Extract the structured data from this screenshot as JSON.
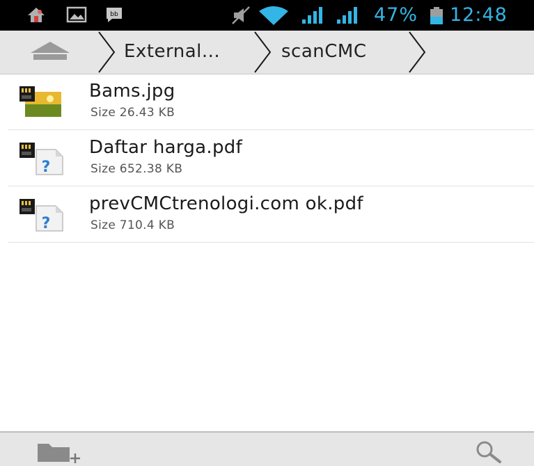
{
  "status_bar": {
    "icons": [
      "home-notification-icon",
      "gallery-notification-icon",
      "bbm-notification-icon",
      "mute-icon",
      "wifi-icon",
      "signal-icon",
      "signal-icon",
      "battery-icon"
    ],
    "battery": "47%",
    "time": "12:48",
    "accent_color": "#33b5e5"
  },
  "breadcrumb": {
    "home_icon": "home-icon",
    "items": [
      {
        "label": "External..."
      },
      {
        "label": "scanCMC"
      }
    ]
  },
  "files": [
    {
      "name": "Bams.jpg",
      "size": "Size 26.43 KB",
      "icon": "image-file-icon"
    },
    {
      "name": "Daftar harga.pdf",
      "size": "Size 652.38 KB",
      "icon": "unknown-file-icon"
    },
    {
      "name": "prevCMCtrenologi.com ok.pdf",
      "size": "Size 710.4 KB",
      "icon": "unknown-file-icon"
    }
  ],
  "toolbar": {
    "new_folder_icon": "new-folder-icon",
    "search_icon": "search-icon"
  }
}
